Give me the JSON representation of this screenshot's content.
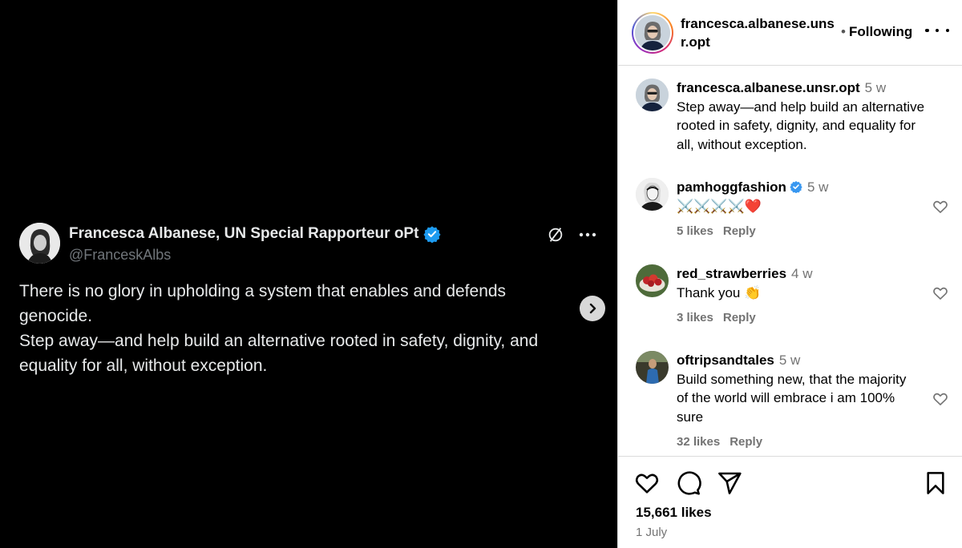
{
  "tweet": {
    "name": "Francesca Albanese, UN Special Rapporteur oPt",
    "handle": "@FranceskAlbs",
    "text_line1": "There is no glory in upholding a system that enables and defends genocide.",
    "text_line2": "Step away—and help build an alternative rooted in safety, dignity, and equality for all, without exception."
  },
  "header": {
    "username": "francesca.albanese.unsr.opt",
    "follow_label": "Following",
    "separator": "•"
  },
  "caption": {
    "username": "francesca.albanese.unsr.opt",
    "time": "5 w",
    "text": "Step away—and help build an alternative rooted in safety, dignity, and equality for all, without exception."
  },
  "comments": [
    {
      "username": "pamhoggfashion",
      "verified": true,
      "time": "5 w",
      "text": "⚔️⚔️⚔️⚔️❤️",
      "likes": "5 likes",
      "reply": "Reply"
    },
    {
      "username": "red_strawberries",
      "verified": false,
      "time": "4 w",
      "text": "Thank you 👏",
      "likes": "3 likes",
      "reply": "Reply"
    },
    {
      "username": "oftripsandtales",
      "verified": false,
      "time": "5 w",
      "text": "Build something new, that the majority of the world will embrace i am 100% sure",
      "likes": "32 likes",
      "reply": "Reply"
    }
  ],
  "post": {
    "likes": "15,661 likes",
    "date": "1 July"
  },
  "colors": {
    "verified": "#1d9bf0",
    "ig_verified": "#3897f0",
    "muted": "#737373"
  },
  "icons": [
    "grok-icon",
    "more-icon",
    "chevron-right-icon",
    "heart-icon",
    "comment-icon",
    "share-icon",
    "bookmark-icon"
  ]
}
